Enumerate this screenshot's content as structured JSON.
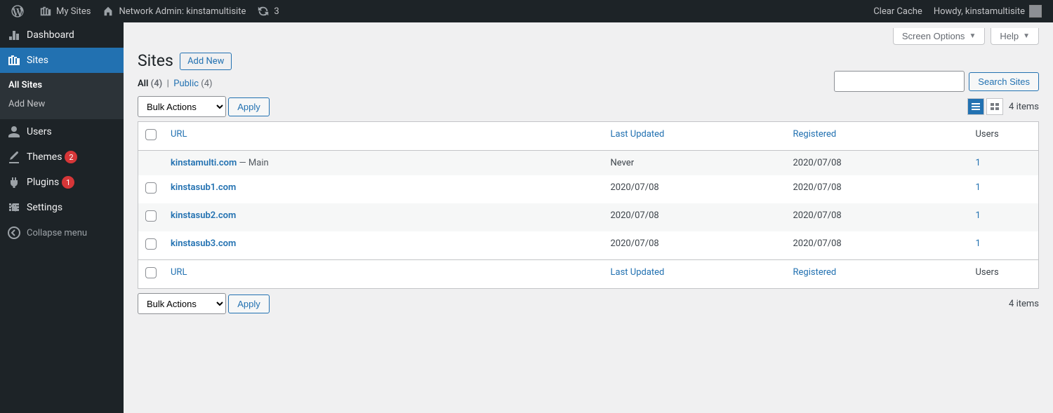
{
  "adminbar": {
    "my_sites": "My Sites",
    "network_admin": "Network Admin: kinstamultisite",
    "updates": "3",
    "clear_cache": "Clear Cache",
    "howdy": "Howdy, kinstamultisite"
  },
  "sidebar": {
    "dashboard": "Dashboard",
    "sites": "Sites",
    "all_sites": "All Sites",
    "add_new": "Add New",
    "users": "Users",
    "themes": "Themes",
    "themes_badge": "2",
    "plugins": "Plugins",
    "plugins_badge": "1",
    "settings": "Settings",
    "collapse": "Collapse menu"
  },
  "page": {
    "title": "Sites",
    "add_new": "Add New",
    "screen_options": "Screen Options",
    "help": "Help",
    "filters": {
      "all_label": "All",
      "all_count": "(4)",
      "public_label": "Public",
      "public_count": "(4)"
    },
    "search_btn": "Search Sites",
    "bulk_placeholder": "Bulk Actions",
    "apply": "Apply",
    "items_label": "4 items"
  },
  "columns": {
    "url": "URL",
    "last_updated": "Last Updated",
    "registered": "Registered",
    "users": "Users"
  },
  "rows": [
    {
      "url": "kinstamulti.com",
      "suffix": " — Main",
      "checkbox": false,
      "updated": "Never",
      "registered": "2020/07/08",
      "users": "1"
    },
    {
      "url": "kinstasub1.com",
      "suffix": "",
      "checkbox": true,
      "updated": "2020/07/08",
      "registered": "2020/07/08",
      "users": "1"
    },
    {
      "url": "kinstasub2.com",
      "suffix": "",
      "checkbox": true,
      "updated": "2020/07/08",
      "registered": "2020/07/08",
      "users": "1"
    },
    {
      "url": "kinstasub3.com",
      "suffix": "",
      "checkbox": true,
      "updated": "2020/07/08",
      "registered": "2020/07/08",
      "users": "1"
    }
  ]
}
